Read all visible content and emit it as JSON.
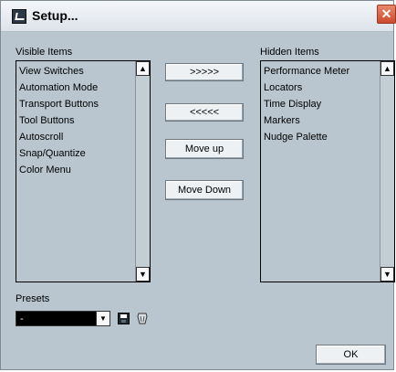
{
  "window": {
    "title": "Setup...",
    "close_glyph": "✕"
  },
  "visible_items": {
    "label": "Visible Items",
    "items": [
      "View Switches",
      "Automation Mode",
      "Transport Buttons",
      "Tool Buttons",
      "Autoscroll",
      "Snap/Quantize",
      "Color Menu"
    ]
  },
  "hidden_items": {
    "label": "Hidden Items",
    "items": [
      "Performance Meter",
      "Locators",
      "Time Display",
      "Markers",
      "Nudge Palette"
    ]
  },
  "buttons": {
    "move_right": ">>>>>",
    "move_left": "<<<<<",
    "move_up": "Move up",
    "move_down": "Move Down",
    "ok": "OK"
  },
  "presets": {
    "label": "Presets",
    "selected": "-"
  },
  "scroll": {
    "up_glyph": "▲",
    "down_glyph": "▼",
    "combo_glyph": "▼"
  },
  "icons": {
    "title": "app-icon",
    "save": "save-icon",
    "delete": "delete-icon"
  }
}
